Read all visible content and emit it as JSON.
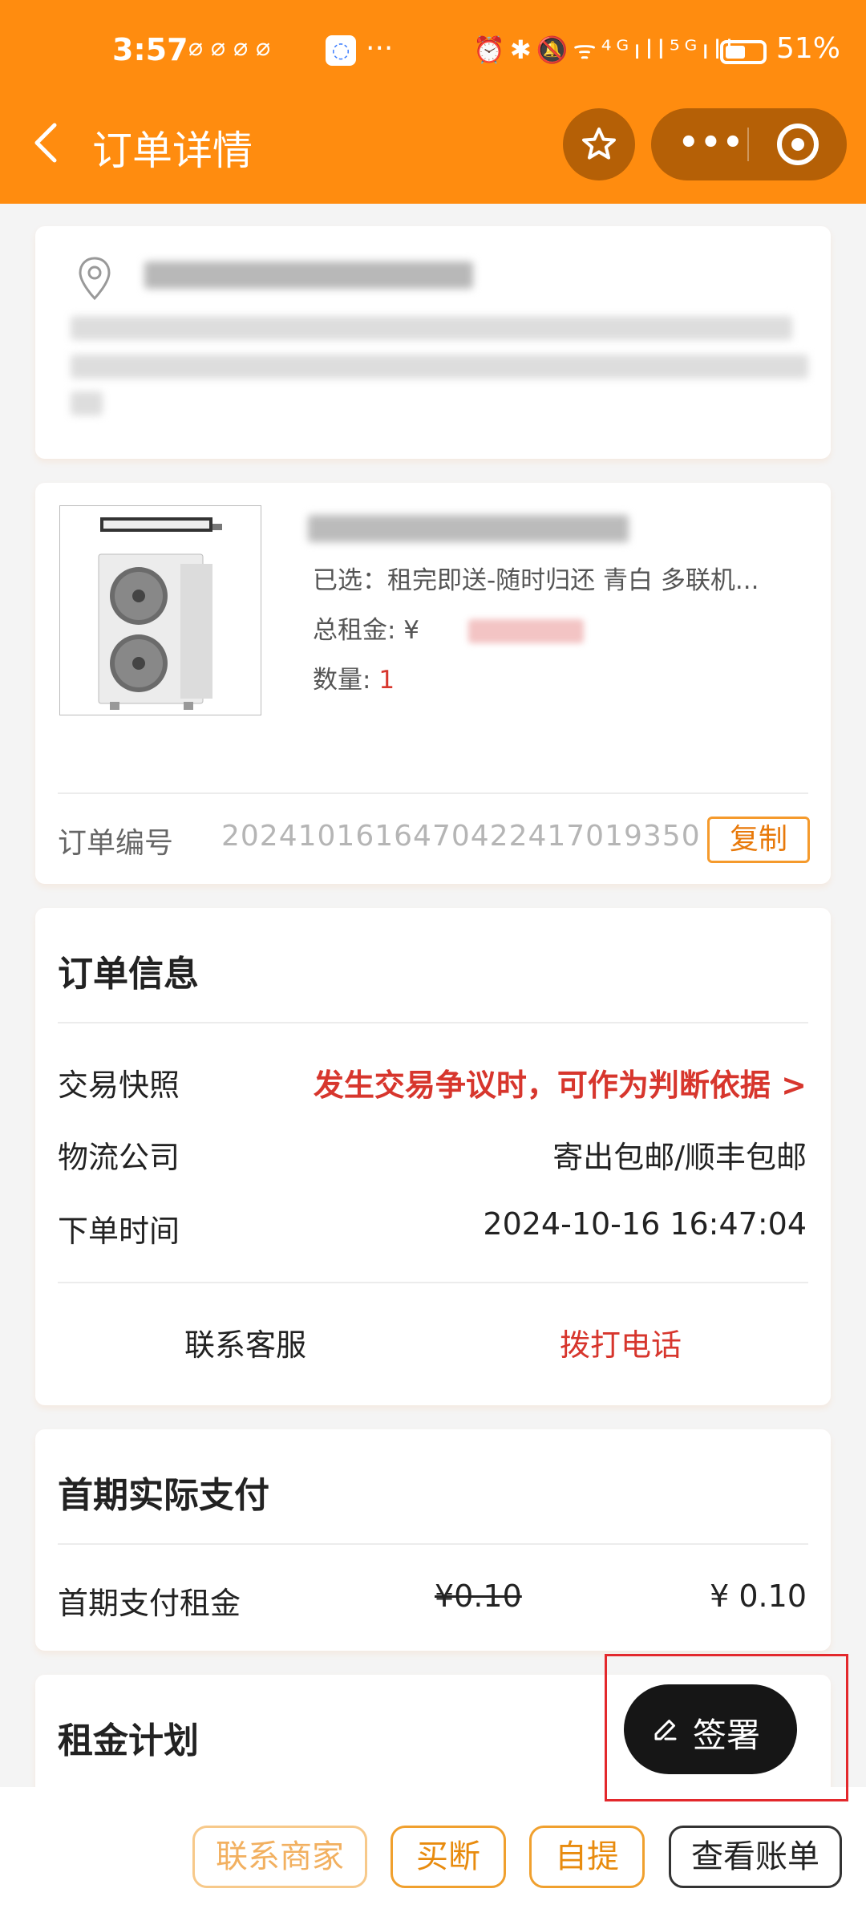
{
  "status_bar": {
    "time": "3:57",
    "battery": "51%",
    "notification_icons": "⌀⌀⌀⌀",
    "chat_icon_glyph": "◌",
    "more": "···",
    "system_icons": "⏰✱🔕ᯤ⁴ᴳıll⁵ᴳıll"
  },
  "header": {
    "title": "订单详情",
    "menu_dots": "•••"
  },
  "product": {
    "selected": "已选：租完即送-随时归还 青白 多联机...",
    "total_label": "总租金: ¥",
    "quantity_label": "数量: ",
    "quantity_value": "1",
    "order_no_label": "订单编号",
    "order_no": "20241016164704224170193​50",
    "copy_label": "复制"
  },
  "order_info": {
    "title": "订单信息",
    "rows": [
      {
        "label": "交易快照",
        "value": "发生交易争议时，可作为判断依据 >"
      },
      {
        "label": "物流公司",
        "value": "寄出包邮/顺丰包邮"
      },
      {
        "label": "下单时间",
        "value": "2024-10-16 16:47:04"
      }
    ],
    "contact_service": "联系客服",
    "call_phone": "拨打电话"
  },
  "first_payment": {
    "title": "首期实际支付",
    "label": "首期支付租金",
    "original": "¥0.10",
    "actual": "¥ 0.10"
  },
  "rent_plan": {
    "title": "租金计划"
  },
  "floating": {
    "sign_label": "签署"
  },
  "bottom_bar": {
    "contact_merchant": "联系商家",
    "buyout": "买断",
    "pickup": "自提",
    "view_bill": "查看账单"
  },
  "colors": {
    "header": "#ff8c0f",
    "accent_red": "#d7362d",
    "accent_orange": "#e88b0e"
  }
}
